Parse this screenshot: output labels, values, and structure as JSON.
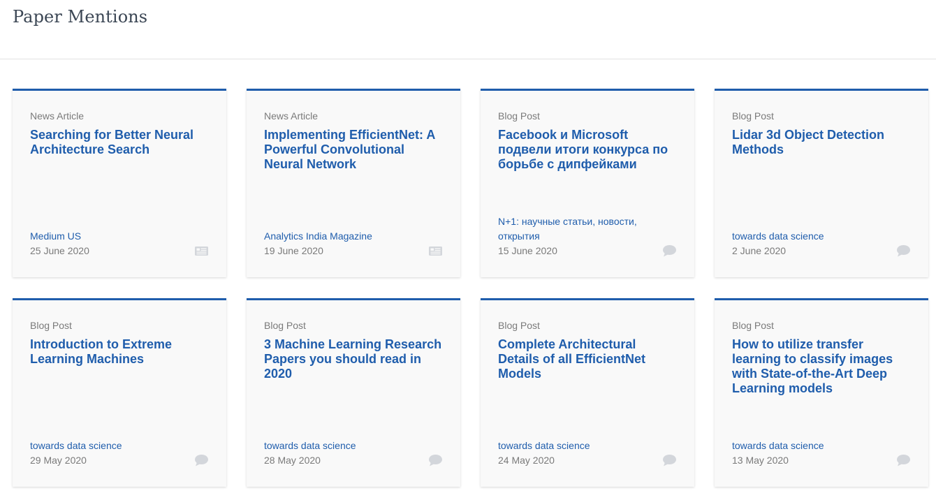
{
  "page": {
    "title": "Paper Mentions"
  },
  "mentions": [
    {
      "type": "News Article",
      "title": "Searching for Better Neural Architecture Search",
      "source": "Medium US",
      "date": "25 June 2020",
      "icon": "newspaper-icon"
    },
    {
      "type": "News Article",
      "title": "Implementing EfficientNet: A Powerful Convolutional Neural Network",
      "source": "Analytics India Magazine",
      "date": "19 June 2020",
      "icon": "newspaper-icon"
    },
    {
      "type": "Blog Post",
      "title": "Facebook и Microsoft подвели итоги конкурса по борьбе с дипфейками",
      "source": "N+1: научные статьи, новости, открытия",
      "date": "15 June 2020",
      "icon": "speech-bubble-icon"
    },
    {
      "type": "Blog Post",
      "title": "Lidar 3d Object Detection Methods",
      "source": "towards data science",
      "date": "2 June 2020",
      "icon": "speech-bubble-icon"
    },
    {
      "type": "Blog Post",
      "title": "Introduction to Extreme Learning Machines",
      "source": "towards data science",
      "date": "29 May 2020",
      "icon": "speech-bubble-icon"
    },
    {
      "type": "Blog Post",
      "title": "3 Machine Learning Research Papers you should read in 2020",
      "source": "towards data science",
      "date": "28 May 2020",
      "icon": "speech-bubble-icon"
    },
    {
      "type": "Blog Post",
      "title": "Complete Architectural Details of all EfficientNet Models",
      "source": "towards data science",
      "date": "24 May 2020",
      "icon": "speech-bubble-icon"
    },
    {
      "type": "Blog Post",
      "title": "How to utilize transfer learning to classify images with State-of-the-Art Deep Learning models",
      "source": "towards data science",
      "date": "13 May 2020",
      "icon": "speech-bubble-icon"
    }
  ],
  "colors": {
    "accent": "#1f5dac",
    "card_background": "#f9f9f9",
    "muted_text": "#7a7a7a",
    "title_text": "#3b4654",
    "icon": "#d3d6db"
  }
}
